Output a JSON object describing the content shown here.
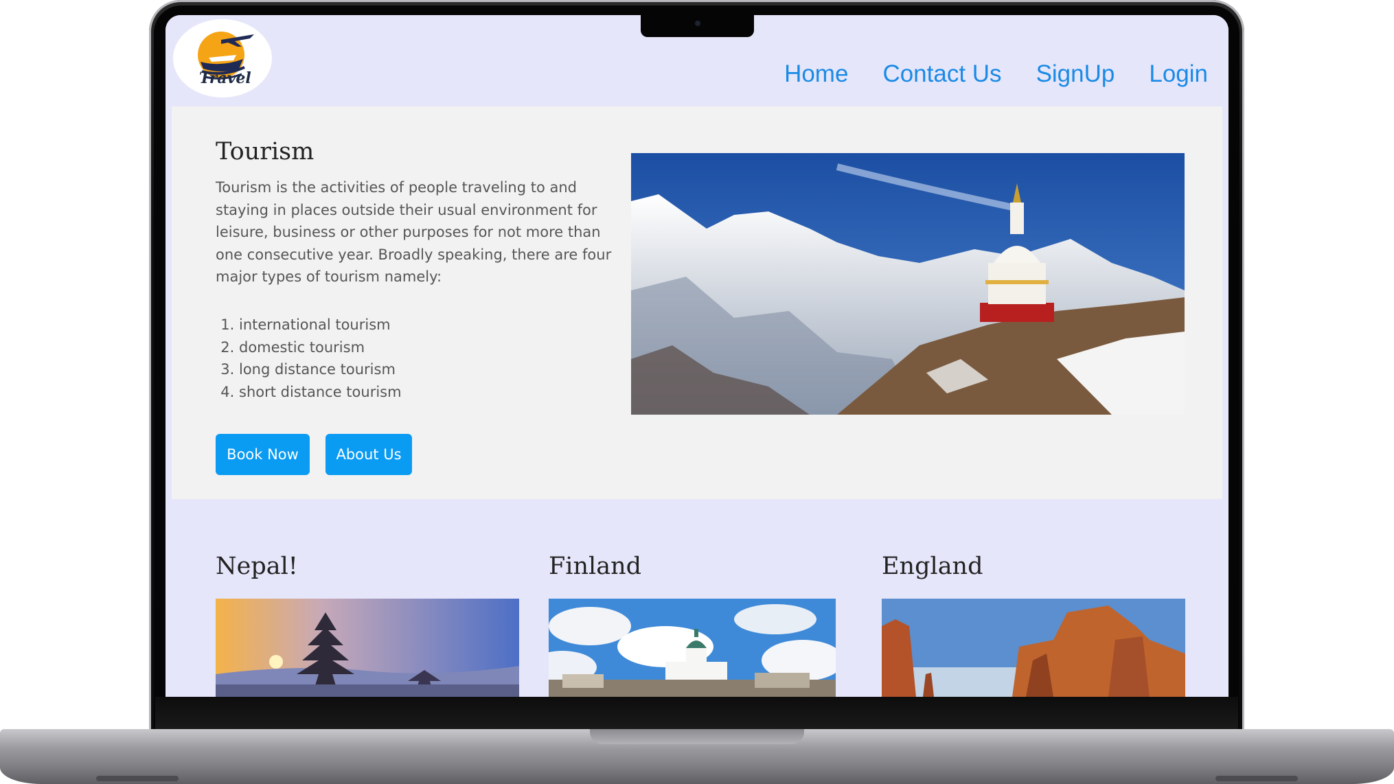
{
  "header": {
    "logo_text": "Travel",
    "nav": [
      "Home",
      "Contact Us",
      "SignUp",
      "Login"
    ]
  },
  "hero": {
    "title": "Tourism",
    "text": "Tourism is the activities of people traveling to and staying in places outside their usual environment for leisure, business or other purposes for not more than one consecutive year. Broadly speaking, there are four major types of tourism namely:",
    "types": [
      "international tourism",
      "domestic tourism",
      "long distance tourism",
      "short distance tourism"
    ],
    "book_button": "Book Now",
    "about_button": "About Us"
  },
  "destinations": [
    {
      "title": "Nepal!"
    },
    {
      "title": "Finland"
    },
    {
      "title": "England"
    }
  ],
  "colors": {
    "nav_link": "#1a8ae6",
    "button": "#0a9bf2",
    "page_bg": "#e6e6fa",
    "hero_bg": "#f2f2f2"
  }
}
